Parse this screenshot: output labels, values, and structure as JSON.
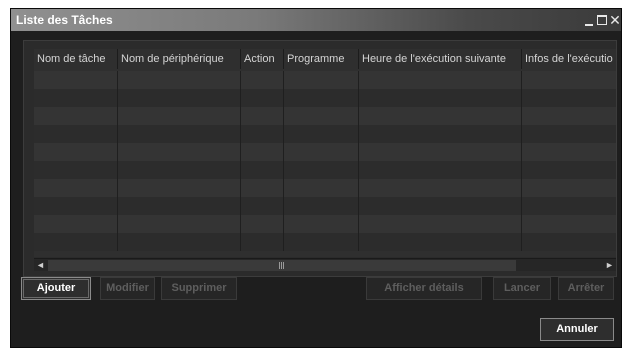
{
  "window": {
    "title": "Liste des Tâches",
    "controls": {
      "minimize": "minimize-icon",
      "maximize": "maximize-icon",
      "close": "✕"
    }
  },
  "table": {
    "columns": [
      "Nom de tâche",
      "Nom de périphérique",
      "Action",
      "Programme",
      "Heure de l'exécution suivante",
      "Infos de l'exécutio"
    ],
    "rows": []
  },
  "scrollbar": {
    "left_arrow": "◄",
    "right_arrow": "►"
  },
  "buttons": {
    "add": "Ajouter",
    "edit": "Modifier",
    "delete": "Supprimer",
    "details": "Afficher détails",
    "launch": "Lancer",
    "stop": "Arrêter",
    "cancel": "Annuler"
  }
}
